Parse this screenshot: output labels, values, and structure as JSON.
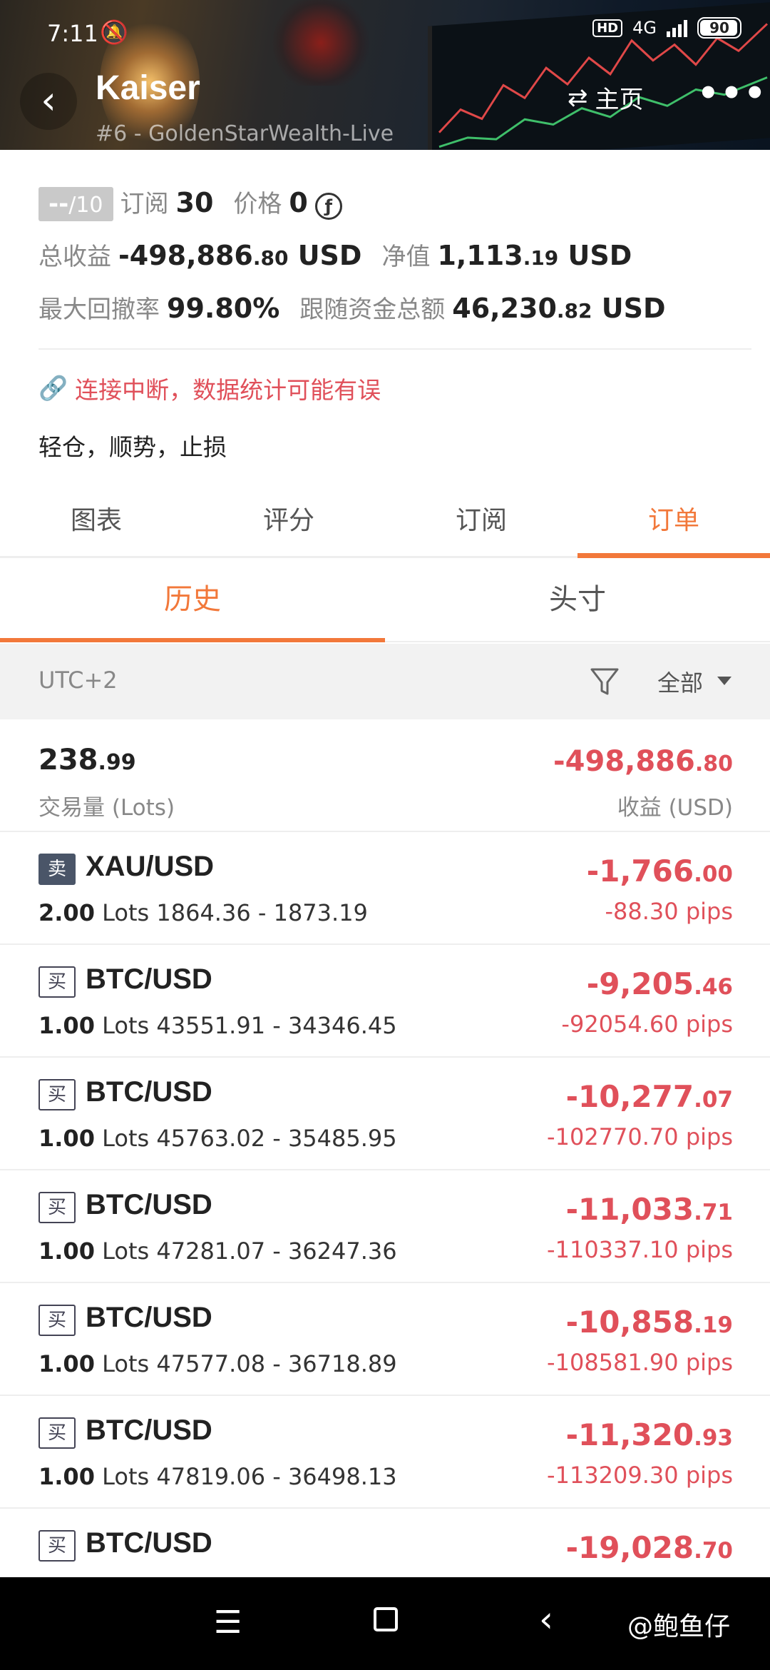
{
  "status_bar": {
    "time": "7:11",
    "hd": "HD",
    "network": "4G",
    "battery": "90"
  },
  "header": {
    "title": "Kaiser",
    "subtitle": "#6 - GoldenStarWealth-Live",
    "home_label": "主页"
  },
  "stats": {
    "score": "--",
    "score_max": "/10",
    "subscribe_label": "订阅",
    "subscribe_value": "30",
    "price_label": "价格",
    "price_value": "0",
    "total_profit_label": "总收益",
    "total_profit_main": "-498,886",
    "total_profit_dec": ".80",
    "total_profit_unit": "USD",
    "net_label": "净值",
    "net_main": "1,113",
    "net_dec": ".19",
    "net_unit": "USD",
    "drawdown_label": "最大回撤率",
    "drawdown_value": "99.80%",
    "follow_label": "跟随资金总额",
    "follow_main": "46,230",
    "follow_dec": ".82",
    "follow_unit": "USD"
  },
  "warning": "连接中断，数据统计可能有误",
  "motto": "轻仓，顺势，止损",
  "tabs": [
    "图表",
    "评分",
    "订阅",
    "订单"
  ],
  "subtabs": [
    "历史",
    "头寸"
  ],
  "filter": {
    "timezone": "UTC+2",
    "scope": "全部"
  },
  "summary": {
    "lots_main": "238",
    "lots_dec": ".99",
    "lots_label": "交易量 (Lots)",
    "profit_main": "-498,886",
    "profit_dec": ".80",
    "profit_label": "收益 (USD)"
  },
  "orders": [
    {
      "side": "卖",
      "symbol": "XAU/USD",
      "lots": "2.00",
      "lots_unit": "Lots",
      "prices": "1864.36 - 1873.19",
      "profit_main": "-1,766",
      "profit_dec": ".00",
      "pips": "-88.30 pips"
    },
    {
      "side": "买",
      "symbol": "BTC/USD",
      "lots": "1.00",
      "lots_unit": "Lots",
      "prices": "43551.91 - 34346.45",
      "profit_main": "-9,205",
      "profit_dec": ".46",
      "pips": "-92054.60 pips"
    },
    {
      "side": "买",
      "symbol": "BTC/USD",
      "lots": "1.00",
      "lots_unit": "Lots",
      "prices": "45763.02 - 35485.95",
      "profit_main": "-10,277",
      "profit_dec": ".07",
      "pips": "-102770.70 pips"
    },
    {
      "side": "买",
      "symbol": "BTC/USD",
      "lots": "1.00",
      "lots_unit": "Lots",
      "prices": "47281.07 - 36247.36",
      "profit_main": "-11,033",
      "profit_dec": ".71",
      "pips": "-110337.10 pips"
    },
    {
      "side": "买",
      "symbol": "BTC/USD",
      "lots": "1.00",
      "lots_unit": "Lots",
      "prices": "47577.08 - 36718.89",
      "profit_main": "-10,858",
      "profit_dec": ".19",
      "pips": "-108581.90 pips"
    },
    {
      "side": "买",
      "symbol": "BTC/USD",
      "lots": "1.00",
      "lots_unit": "Lots",
      "prices": "47819.06 - 36498.13",
      "profit_main": "-11,320",
      "profit_dec": ".93",
      "pips": "-113209.30 pips"
    },
    {
      "side": "买",
      "symbol": "BTC/USD",
      "profit_main": "-19,028",
      "profit_dec": ".70"
    }
  ],
  "watermark": "@鲍鱼仔",
  "colors": {
    "accent": "#f2783a",
    "loss": "#e0505a"
  }
}
